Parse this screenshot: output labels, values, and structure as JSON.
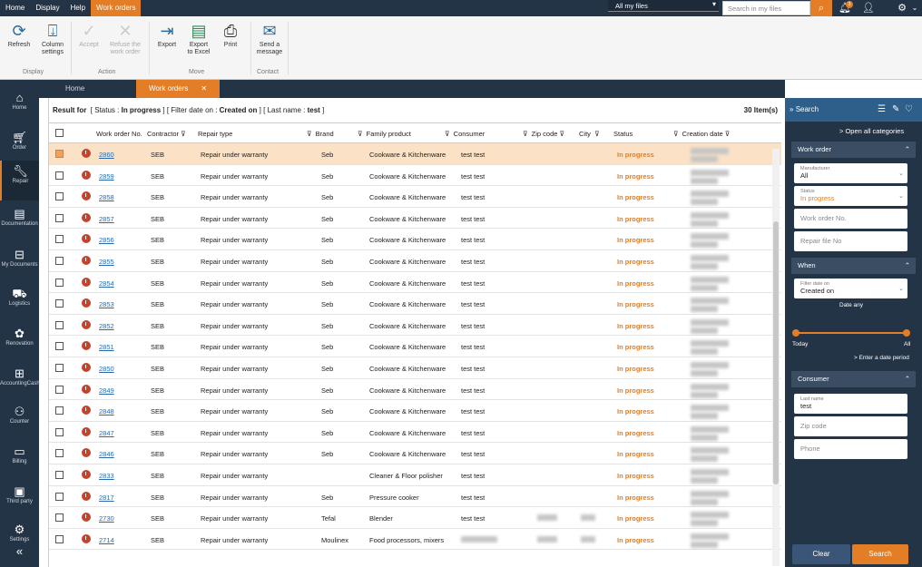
{
  "menu": {
    "items": [
      "Home",
      "Display",
      "Help",
      "Work orders"
    ]
  },
  "filter": {
    "select_value": "All my files",
    "search_placeholder": "Search in my files",
    "notif_count": "3"
  },
  "ribbon": {
    "refresh": "Refresh",
    "column_settings_1": "Column",
    "column_settings_2": "settings",
    "group_display": "Display",
    "accept": "Accept",
    "refuse_1": "Refuse the",
    "refuse_2": "work order",
    "group_action": "Action",
    "export": "Export",
    "export_excel_1": "Export",
    "export_excel_2": "to Excel",
    "print": "Print",
    "group_move": "Move",
    "send_1": "Send a",
    "send_2": "message",
    "group_contact": "Contact"
  },
  "sidebar": {
    "items": [
      "Home",
      "Order",
      "Repair",
      "Documentation",
      "My Documents",
      "Logistics",
      "Renovation",
      "AccountingCash",
      "Counter",
      "Billing",
      "Third party",
      "Settings"
    ]
  },
  "tabs": {
    "home": "Home",
    "work_orders": "Work orders"
  },
  "result": {
    "prefix": "Result for",
    "status_label": "[ Status : ",
    "status_value": "In progress",
    "filter_label": " ]  [ Filter date on : ",
    "filter_value": "Created on",
    "lastname_label": " ]  [ Last name : ",
    "lastname_value": "test",
    "suffix": " ]",
    "count": "30 Item(s)"
  },
  "columns": {
    "work_order": "Work order No.",
    "contractor": "Contractor",
    "repair_type": "Repair type",
    "brand": "Brand",
    "family": "Family product",
    "consumer": "Consumer",
    "zip": "Zip code",
    "city": "City",
    "status": "Status",
    "creation": "Creation date"
  },
  "rows": [
    {
      "no": "2860",
      "contractor": "SEB",
      "type": "Repair under warranty",
      "brand": "Seb",
      "family": "Cookware & Kitchenware",
      "consumer": "test test",
      "status": "In progress"
    },
    {
      "no": "2859",
      "contractor": "SEB",
      "type": "Repair under warranty",
      "brand": "Seb",
      "family": "Cookware & Kitchenware",
      "consumer": "test test",
      "status": "In progress"
    },
    {
      "no": "2858",
      "contractor": "SEB",
      "type": "Repair under warranty",
      "brand": "Seb",
      "family": "Cookware & Kitchenware",
      "consumer": "test test",
      "status": "In progress"
    },
    {
      "no": "2857",
      "contractor": "SEB",
      "type": "Repair under warranty",
      "brand": "Seb",
      "family": "Cookware & Kitchenware",
      "consumer": "test test",
      "status": "In progress"
    },
    {
      "no": "2856",
      "contractor": "SEB",
      "type": "Repair under warranty",
      "brand": "Seb",
      "family": "Cookware & Kitchenware",
      "consumer": "test test",
      "status": "In progress"
    },
    {
      "no": "2855",
      "contractor": "SEB",
      "type": "Repair under warranty",
      "brand": "Seb",
      "family": "Cookware & Kitchenware",
      "consumer": "test test",
      "status": "In progress"
    },
    {
      "no": "2854",
      "contractor": "SEB",
      "type": "Repair under warranty",
      "brand": "Seb",
      "family": "Cookware & Kitchenware",
      "consumer": "test test",
      "status": "In progress"
    },
    {
      "no": "2853",
      "contractor": "SEB",
      "type": "Repair under warranty",
      "brand": "Seb",
      "family": "Cookware & Kitchenware",
      "consumer": "test test",
      "status": "In progress"
    },
    {
      "no": "2852",
      "contractor": "SEB",
      "type": "Repair under warranty",
      "brand": "Seb",
      "family": "Cookware & Kitchenware",
      "consumer": "test test",
      "status": "In progress"
    },
    {
      "no": "2851",
      "contractor": "SEB",
      "type": "Repair under warranty",
      "brand": "Seb",
      "family": "Cookware & Kitchenware",
      "consumer": "test test",
      "status": "In progress"
    },
    {
      "no": "2850",
      "contractor": "SEB",
      "type": "Repair under warranty",
      "brand": "Seb",
      "family": "Cookware & Kitchenware",
      "consumer": "test test",
      "status": "In progress"
    },
    {
      "no": "2849",
      "contractor": "SEB",
      "type": "Repair under warranty",
      "brand": "Seb",
      "family": "Cookware & Kitchenware",
      "consumer": "test test",
      "status": "In progress"
    },
    {
      "no": "2848",
      "contractor": "SEB",
      "type": "Repair under warranty",
      "brand": "Seb",
      "family": "Cookware & Kitchenware",
      "consumer": "test test",
      "status": "In progress"
    },
    {
      "no": "2847",
      "contractor": "SEB",
      "type": "Repair under warranty",
      "brand": "Seb",
      "family": "Cookware & Kitchenware",
      "consumer": "test test",
      "status": "In progress"
    },
    {
      "no": "2846",
      "contractor": "SEB",
      "type": "Repair under warranty",
      "brand": "Seb",
      "family": "Cookware & Kitchenware",
      "consumer": "test test",
      "status": "In progress"
    },
    {
      "no": "2833",
      "contractor": "SEB",
      "type": "Repair under warranty",
      "brand": "",
      "family": "Cleaner & Floor polisher",
      "consumer": "test test",
      "status": "In progress"
    },
    {
      "no": "2817",
      "contractor": "SEB",
      "type": "Repair under warranty",
      "brand": "Seb",
      "family": "Pressure cooker",
      "consumer": "test test",
      "status": "In progress"
    },
    {
      "no": "2730",
      "contractor": "SEB",
      "type": "Repair under warranty",
      "brand": "Tefal",
      "family": "Blender",
      "consumer": "test test",
      "status": "In progress"
    },
    {
      "no": "2714",
      "contractor": "SEB",
      "type": "Repair under warranty",
      "brand": "Moulinex",
      "family": "Food processors, mixers",
      "consumer": "",
      "status": "In progress"
    }
  ],
  "search_panel": {
    "title": "Search",
    "open_all": "Open all categories",
    "sec_work_order": "Work order",
    "manufacturer_label": "Manufacturer",
    "manufacturer_value": "All",
    "status_label": "Status",
    "status_value": "In progress",
    "work_order_ph": "Work order No.",
    "repair_file_ph": "Repair file No",
    "sec_when": "When",
    "filter_date_label": "Filter date on",
    "filter_date_value": "Created on",
    "date_any": "Date any",
    "today": "Today",
    "all": "All",
    "enter_period": "> Enter a date period",
    "sec_consumer": "Consumer",
    "lastname_label": "Last name",
    "lastname_value": "test",
    "zip_ph": "Zip code",
    "phone_ph": "Phone",
    "clear": "Clear",
    "search": "Search"
  },
  "colors": {
    "accent": "#e37d26",
    "navy": "#243447",
    "link": "#2b6aaa"
  }
}
